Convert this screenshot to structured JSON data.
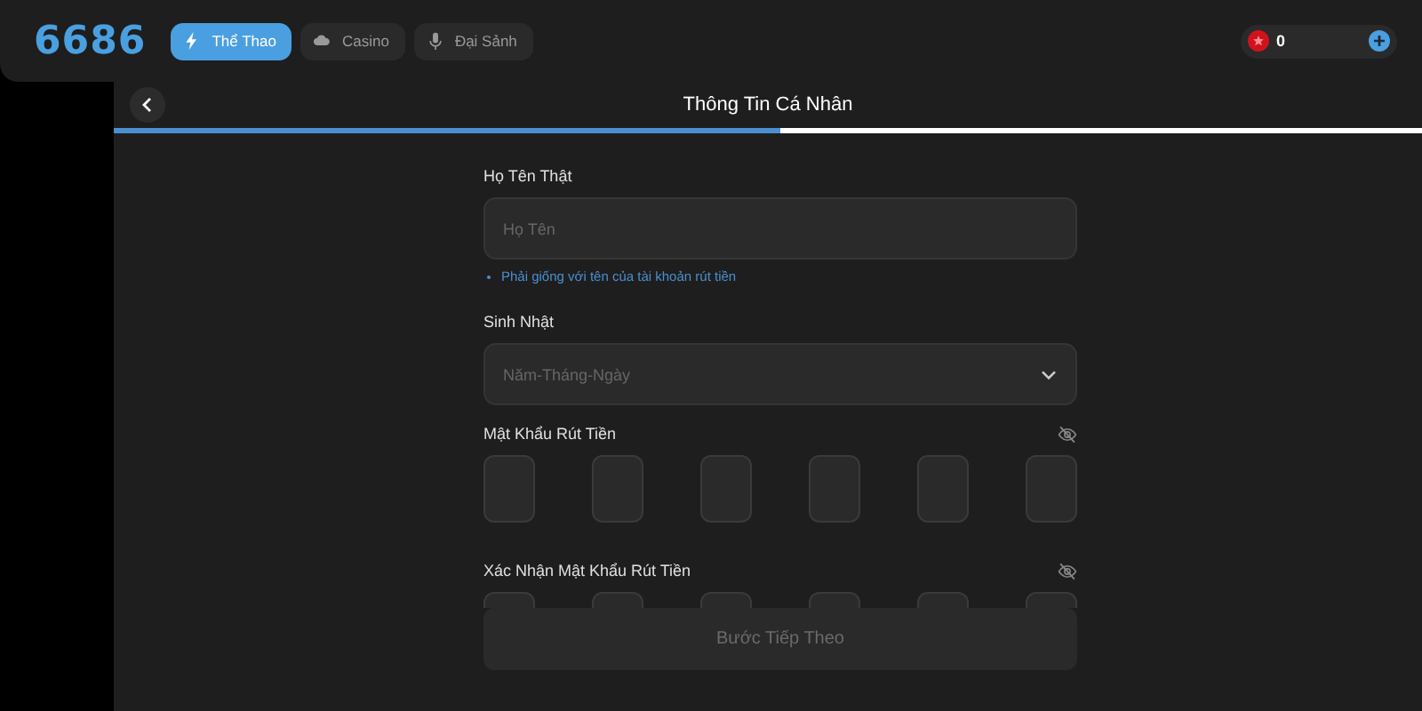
{
  "header": {
    "logo": "6686",
    "tabs": [
      {
        "label": "Thể Thao",
        "kind": "bolt",
        "selected": true
      },
      {
        "label": "Casino",
        "kind": "cloud",
        "selected": false
      },
      {
        "label": "Đại Sảnh",
        "kind": "mic",
        "selected": false
      }
    ],
    "balance": "0"
  },
  "page": {
    "title": "Thông Tin Cá Nhân",
    "progress": {
      "level": 0.51
    }
  },
  "form": {
    "fields": [
      {
        "kind": "text",
        "label": "Họ Tên Thật",
        "placeholder": "Họ Tên",
        "hint": "Phải giống với tên của tài khoản rút tiền"
      },
      {
        "kind": "date",
        "label": "Sinh Nhật",
        "placeholder": "Năm-Tháng-Ngày"
      },
      {
        "kind": "pin",
        "label": "Mật Khẩu Rút Tiền",
        "visible": false
      },
      {
        "kind": "pin",
        "label": "Xác Nhận Mật Khẩu Rút Tiền",
        "visible": false
      }
    ],
    "submit": {
      "label": "Bước Tiếp Theo",
      "disabled": true
    }
  }
}
